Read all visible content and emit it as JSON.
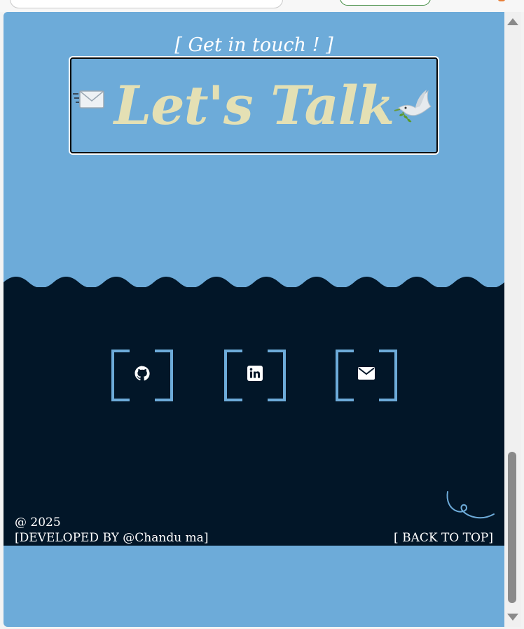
{
  "header": {
    "subtitle": "[ Get in touch ! ]",
    "title": "Let's Talk"
  },
  "icons": {
    "left": "envelope-icon",
    "right": "dove-icon"
  },
  "social": [
    {
      "name": "github",
      "icon": "github-icon"
    },
    {
      "name": "linkedin",
      "icon": "linkedin-icon"
    },
    {
      "name": "email",
      "icon": "mail-icon"
    }
  ],
  "footer": {
    "copyright": "@ 2025",
    "developed_by": "[DEVELOPED BY @Chandu ma]",
    "back_to_top": "[ BACK TO TOP]"
  },
  "colors": {
    "background": "#6dabd9",
    "footer_bg": "#021628",
    "title_text": "#e4e0b4",
    "accent": "#6dabd9"
  }
}
